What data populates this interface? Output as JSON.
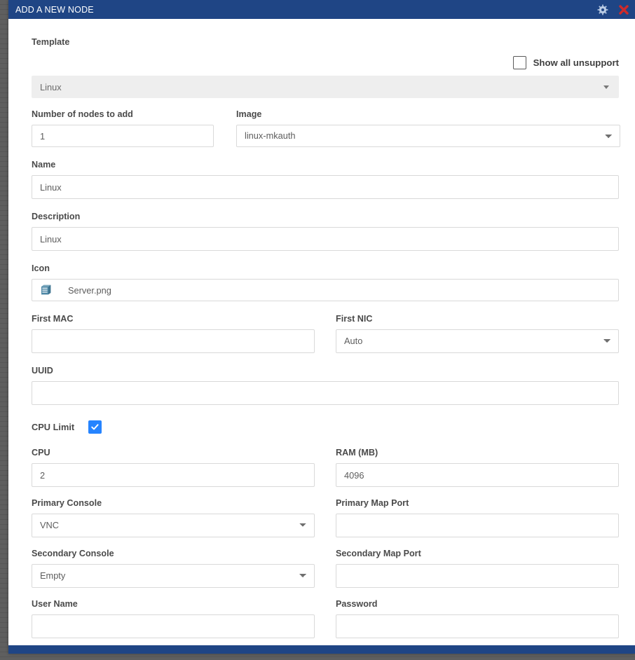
{
  "window": {
    "title": "ADD A NEW NODE",
    "titlebar_color": "#1f4585",
    "gear_icon": "gear-icon",
    "close_icon": "close-icon"
  },
  "form": {
    "template": {
      "label": "Template",
      "value": "Linux",
      "caret_icon": "chevron-down-icon"
    },
    "show_all_unsupported": {
      "label": "Show all unsupport",
      "checked": false
    },
    "nodes_to_add": {
      "label": "Number of nodes to add",
      "value": "1",
      "placeholder": ""
    },
    "image": {
      "label": "Image",
      "value": "linux-mkauth",
      "options": [
        "linux-mkauth"
      ]
    },
    "name": {
      "label": "Name",
      "value": "Linux",
      "placeholder": ""
    },
    "description": {
      "label": "Description",
      "value": "Linux",
      "placeholder": ""
    },
    "icon": {
      "label": "Icon",
      "value": "Server.png",
      "glyph": "server-icon"
    },
    "first_mac": {
      "label": "First MAC",
      "value": "",
      "placeholder": ""
    },
    "first_nic": {
      "label": "First NIC",
      "value": "Auto",
      "options": [
        "Auto"
      ]
    },
    "uuid": {
      "label": "UUID",
      "value": "",
      "placeholder": ""
    },
    "cpu_limit": {
      "label": "CPU Limit",
      "checked": true,
      "color": "#2684ff"
    },
    "cpu": {
      "label": "CPU",
      "value": "2",
      "placeholder": ""
    },
    "ram": {
      "label": "RAM (MB)",
      "value": "4096",
      "placeholder": ""
    },
    "primary_console": {
      "label": "Primary Console",
      "value": "VNC",
      "options": [
        "VNC"
      ]
    },
    "primary_map_port": {
      "label": "Primary Map Port",
      "value": "",
      "placeholder": ""
    },
    "secondary_console": {
      "label": "Secondary Console",
      "value": "Empty",
      "options": [
        "Empty"
      ]
    },
    "secondary_map_port": {
      "label": "Secondary Map Port",
      "value": "",
      "placeholder": ""
    },
    "user_name": {
      "label": "User Name",
      "value": "",
      "placeholder": ""
    },
    "password": {
      "label": "Password",
      "value": "",
      "placeholder": ""
    }
  }
}
